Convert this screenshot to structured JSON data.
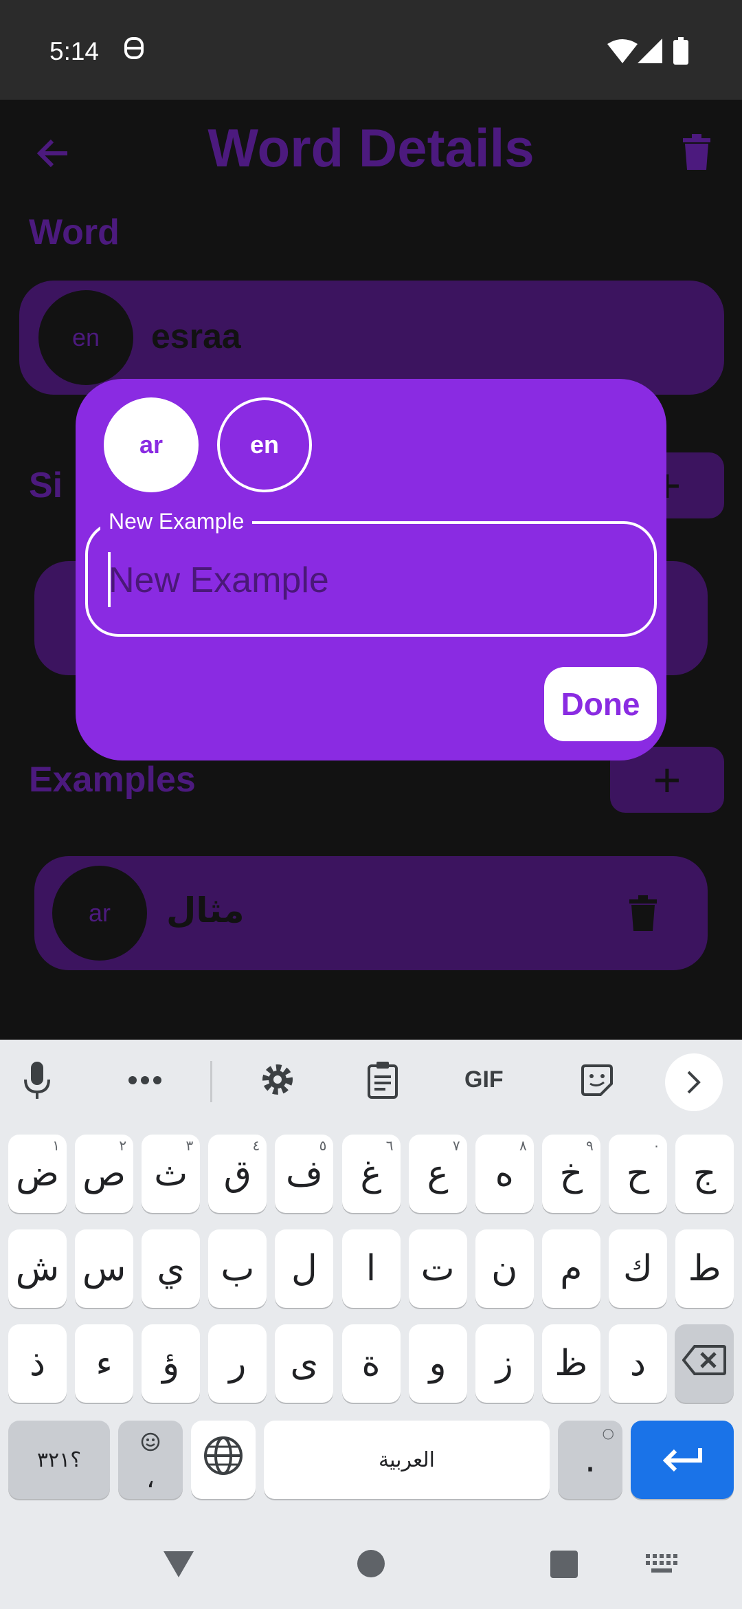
{
  "status_bar": {
    "time": "5:14"
  },
  "screen": {
    "title": "Word Details",
    "word_section_label": "Word",
    "word_card": {
      "lang": "en",
      "text": "esraa"
    },
    "synonyms_section_label_visible": "Si",
    "examples_section_label": "Examples",
    "example_card": {
      "lang": "ar",
      "text": "مثال"
    }
  },
  "dialog": {
    "lang_options": [
      "ar",
      "en"
    ],
    "selected_lang": "ar",
    "field_label": "New Example",
    "field_placeholder": "New Example",
    "field_value": "",
    "done_label": "Done"
  },
  "keyboard": {
    "toolbar": [
      "mic-icon",
      "more-icon",
      "settings-icon",
      "clipboard-icon",
      "gif-icon",
      "sticker-icon",
      "next-icon"
    ],
    "gif_label": "GIF",
    "row1": [
      {
        "k": "ض",
        "h": "١"
      },
      {
        "k": "ص",
        "h": "٢"
      },
      {
        "k": "ث",
        "h": "٣"
      },
      {
        "k": "ق",
        "h": "٤"
      },
      {
        "k": "ف",
        "h": "٥"
      },
      {
        "k": "غ",
        "h": "٦"
      },
      {
        "k": "ع",
        "h": "٧"
      },
      {
        "k": "ه",
        "h": "٨"
      },
      {
        "k": "خ",
        "h": "٩"
      },
      {
        "k": "ح",
        "h": "٠"
      },
      {
        "k": "ج",
        "h": ""
      }
    ],
    "row2": [
      "ش",
      "س",
      "ي",
      "ب",
      "ل",
      "ا",
      "ت",
      "ن",
      "م",
      "ك",
      "ط"
    ],
    "row3": [
      "ذ",
      "ء",
      "ؤ",
      "ر",
      "ى",
      "ة",
      "و",
      "ز",
      "ظ",
      "د"
    ],
    "symbols_label": "؟٣٢١",
    "emoji_comma_label": "،",
    "space_label": "العربية",
    "period_label": "."
  },
  "colors": {
    "accent": "#8a2be2",
    "dim_accent": "#4c1a7e",
    "card_dim": "#3c145f",
    "enter_key": "#1a73e8"
  }
}
